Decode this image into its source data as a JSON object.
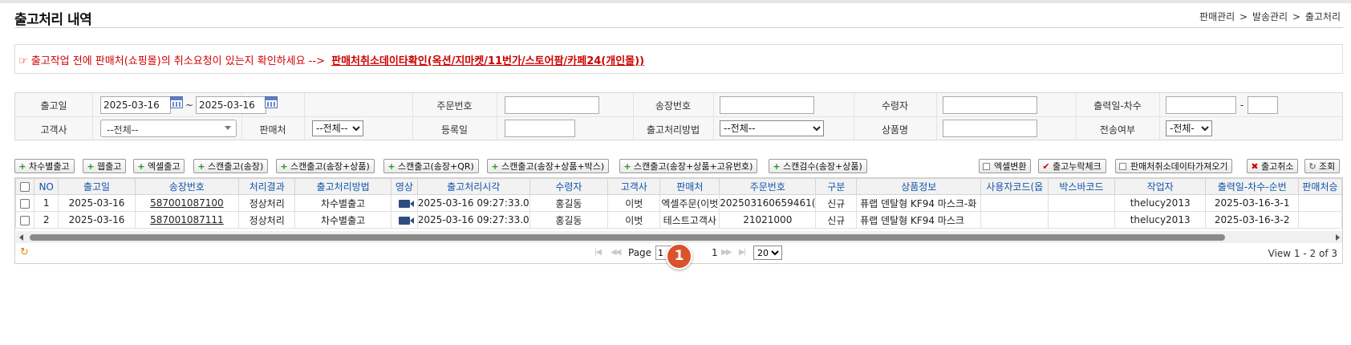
{
  "page": {
    "title": "출고처리 내역",
    "breadcrumb": [
      "판매관리",
      "발송관리",
      "출고처리"
    ],
    "breadcrumb_sep": ">"
  },
  "notice": {
    "text": "☞ 출고작업 전에 판매처(쇼핑몰)의 취소요청이 있는지 확인하세요 -->",
    "link": "판매처취소데이타확인(옥션/지마켓/11번가/스토어팜/카페24(개인몰))",
    "color": "#d00000"
  },
  "filters": {
    "ship_date_label": "출고일",
    "ship_date_from": "2025-03-16",
    "ship_date_tilde": "~",
    "ship_date_to": "2025-03-16",
    "order_no_label": "주문번호",
    "order_no_value": "",
    "tracking_no_label": "송장번호",
    "tracking_no_value": "",
    "recipient_label": "수령자",
    "recipient_value": "",
    "print_date_label": "출력일-차수",
    "print_date_value": "",
    "print_dash": "-",
    "print_seq_value": "",
    "customer_label": "고객사",
    "customer_selected": "--전체--",
    "seller_label": "판매처",
    "seller_selected": "--전체--",
    "reg_date_label": "등록일",
    "reg_date_value": "",
    "method_label": "출고처리방법",
    "method_selected": "--전체--",
    "product_label": "상품명",
    "product_value": "",
    "transfer_label": "전송여부",
    "transfer_selected": "-전체-"
  },
  "toolbar_left": [
    {
      "label": "차수별출고",
      "icon": "plus-icon"
    },
    {
      "label": "웹출고",
      "icon": "plus-icon"
    },
    {
      "label": "엑셀출고",
      "icon": "plus-icon"
    },
    {
      "label": "스캔출고(송장)",
      "icon": "plus-icon"
    },
    {
      "label": "스캔출고(송장+상품)",
      "icon": "plus-icon"
    },
    {
      "label": "스캔출고(송장+QR)",
      "icon": "plus-icon"
    },
    {
      "label": "스캔출고(송장+상품+박스)",
      "icon": "plus-icon"
    },
    {
      "label": "스캔출고(송장+상품+고유번호)",
      "icon": "plus-icon"
    },
    {
      "label": "스캔검수(송장+상품)",
      "icon": "plus-icon"
    }
  ],
  "toolbar_right": [
    {
      "label": "엑셀변환",
      "icon": "checkbox-icon"
    },
    {
      "label": "출고누락체크",
      "icon": "check-icon"
    },
    {
      "label": "판매처취소데이타가져오기",
      "icon": "checkbox-icon"
    },
    {
      "label": "출고취소",
      "icon": "x-icon"
    },
    {
      "label": "조회",
      "icon": "refresh-icon"
    }
  ],
  "table": {
    "columns": [
      "",
      "NO",
      "출고일",
      "송장번호",
      "처리결과",
      "출고처리방법",
      "영상",
      "출고처리시각",
      "수령자",
      "고객사",
      "판매처",
      "주문번호",
      "구분",
      "상품정보",
      "사용자코드(옵",
      "박스바코드",
      "작업자",
      "출력일-차수-순번",
      "판매처승"
    ],
    "rows": [
      {
        "no": "1",
        "date": "2025-03-16",
        "tracking": "587001087100",
        "result": "정상처리",
        "method": "차수별출고",
        "time": "2025-03-16 09:27:33.0",
        "recipient": "홍길동",
        "customer": "이벗",
        "seller": "엑셀주문(이벗",
        "order_no": "202503160659461(",
        "type": "신규",
        "product": "퓨랩 덴탈형 KF94 마스크-화",
        "user_code": "",
        "box_barcode": "",
        "worker": "thelucy2013",
        "print_seq": "2025-03-16-3-1",
        "seller_approve": ""
      },
      {
        "no": "2",
        "date": "2025-03-16",
        "tracking": "587001087111",
        "result": "정상처리",
        "method": "차수별출고",
        "time": "2025-03-16 09:27:33.0",
        "recipient": "홍길동",
        "customer": "이벗",
        "seller": "테스트고객사",
        "order_no": "21021000",
        "type": "신규",
        "product": "퓨랩 덴탈형 KF94 마스크",
        "user_code": "",
        "box_barcode": "",
        "worker": "thelucy2013",
        "print_seq": "2025-03-16-3-2",
        "seller_approve": ""
      }
    ]
  },
  "pager": {
    "page_label": "Page",
    "page_value": "1",
    "total_pages": "1",
    "page_size": "20",
    "view_info": "View 1 - 2 of 3"
  },
  "badge": {
    "label": "1",
    "color": "#d9532c"
  }
}
